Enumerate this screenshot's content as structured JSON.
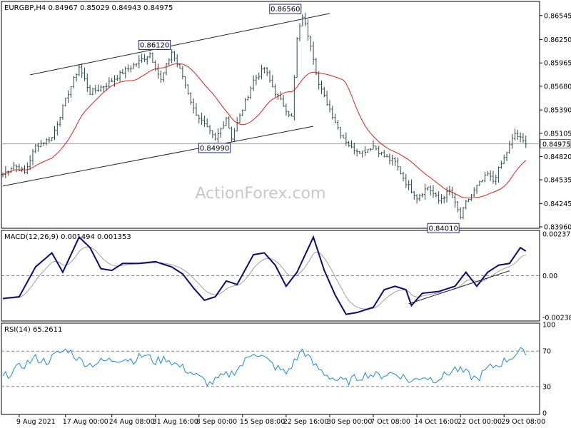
{
  "chart_data": [
    {
      "type": "ohlc",
      "panel": "price",
      "header": "EURGBP,H4  0.84967 0.85029 0.84943 0.84975",
      "ylim": [
        0.8396,
        0.867
      ],
      "y_ticks": [
        "0.86545",
        "0.86250",
        "0.85965",
        "0.85680",
        "0.85390",
        "0.85105",
        "0.84820",
        "0.84535",
        "0.84245",
        "0.83960"
      ],
      "y_tick_values": [
        0.86545,
        0.8625,
        0.85965,
        0.8568,
        0.8539,
        0.85105,
        0.8482,
        0.84535,
        0.84245,
        0.8396
      ],
      "current_price": 0.84975,
      "current_price_label": "0.84975",
      "watermark": "ActionForex.com",
      "annotations": [
        {
          "text": "0.86120",
          "value": 0.8612,
          "bar": 62
        },
        {
          "text": "0.86560",
          "value": 0.8656,
          "bar": 110
        },
        {
          "text": "0.84990",
          "value": 0.8499,
          "bar": 84
        },
        {
          "text": "0.84010",
          "value": 0.8401,
          "bar": 168
        }
      ],
      "channel_lines": [
        {
          "from": {
            "bar": 10,
            "value": 0.8582
          },
          "to": {
            "bar": 120,
            "value": 0.8657
          }
        },
        {
          "from": {
            "bar": 0,
            "value": 0.8446
          },
          "to": {
            "bar": 114,
            "value": 0.8519
          }
        }
      ],
      "ma_color": "#e0201c",
      "bar_color": "#2a4a4a"
    },
    {
      "type": "line",
      "panel": "macd",
      "header": "MACD(12,26,9) 0.001494 0.001353",
      "ylim": [
        -0.0025,
        0.0025
      ],
      "y_ticks": [
        "0.00237",
        "0.00",
        "-0.002387"
      ],
      "y_tick_values": [
        0.00237,
        0.0,
        -0.002387
      ],
      "macd_color": "#0a0a78",
      "signal_color": "#a0a0a0",
      "trend_line": {
        "from": {
          "bar": 149,
          "value": -0.0016
        },
        "to": {
          "bar": 186,
          "value": 0.00028
        }
      }
    },
    {
      "type": "line",
      "panel": "rsi",
      "header": "RSI(14) 65.2611",
      "ylim": [
        0,
        100
      ],
      "y_ticks": [
        "100",
        "70",
        "30",
        "0"
      ],
      "y_tick_values": [
        100,
        70,
        30,
        0
      ],
      "levels": [
        70,
        30
      ],
      "color": "#1e8ad6"
    }
  ],
  "x_axis": {
    "labels": [
      "9 Aug 2021",
      "17 Aug 00:00",
      "24 Aug 08:00",
      "31 Aug 16:00",
      "8 Sep 00:00",
      "15 Sep 08:00",
      "22 Sep 16:00",
      "30 Sep 00:00",
      "7 Oct 08:00",
      "14 Oct 16:00",
      "22 Oct 00:00",
      "29 Oct 08:00"
    ],
    "label_bars": [
      6,
      23,
      40,
      56,
      72,
      88,
      104,
      120,
      136,
      152,
      168,
      184
    ]
  },
  "price_path": [
    [
      0,
      0.846
    ],
    [
      4,
      0.8472
    ],
    [
      8,
      0.8462
    ],
    [
      12,
      0.8495
    ],
    [
      18,
      0.8505
    ],
    [
      24,
      0.856
    ],
    [
      28,
      0.8592
    ],
    [
      32,
      0.856
    ],
    [
      38,
      0.857
    ],
    [
      44,
      0.8585
    ],
    [
      50,
      0.8598
    ],
    [
      54,
      0.8608
    ],
    [
      58,
      0.8575
    ],
    [
      62,
      0.861
    ],
    [
      66,
      0.858
    ],
    [
      70,
      0.854
    ],
    [
      74,
      0.852
    ],
    [
      78,
      0.8502
    ],
    [
      82,
      0.853
    ],
    [
      84,
      0.8505
    ],
    [
      88,
      0.854
    ],
    [
      92,
      0.8575
    ],
    [
      96,
      0.859
    ],
    [
      100,
      0.856
    ],
    [
      104,
      0.854
    ],
    [
      106,
      0.853
    ],
    [
      108,
      0.8625
    ],
    [
      110,
      0.8654
    ],
    [
      113,
      0.862
    ],
    [
      116,
      0.857
    ],
    [
      120,
      0.854
    ],
    [
      124,
      0.851
    ],
    [
      128,
      0.8492
    ],
    [
      132,
      0.8488
    ],
    [
      136,
      0.8495
    ],
    [
      140,
      0.8482
    ],
    [
      144,
      0.8475
    ],
    [
      148,
      0.845
    ],
    [
      152,
      0.8432
    ],
    [
      156,
      0.8445
    ],
    [
      160,
      0.8428
    ],
    [
      164,
      0.844
    ],
    [
      168,
      0.8408
    ],
    [
      170,
      0.8425
    ],
    [
      174,
      0.8445
    ],
    [
      178,
      0.846
    ],
    [
      180,
      0.8452
    ],
    [
      184,
      0.848
    ],
    [
      188,
      0.851
    ],
    [
      192,
      0.8497
    ]
  ],
  "macd_path": [
    [
      0,
      -0.0013
    ],
    [
      6,
      -0.0012
    ],
    [
      12,
      0.0005
    ],
    [
      18,
      0.0013
    ],
    [
      22,
      0.0002
    ],
    [
      28,
      0.0022
    ],
    [
      32,
      0.0016
    ],
    [
      36,
      0.0004
    ],
    [
      40,
      0.0003
    ],
    [
      44,
      0.0007
    ],
    [
      50,
      0.0007
    ],
    [
      56,
      0.0008
    ],
    [
      62,
      0.0005
    ],
    [
      66,
      0.0001
    ],
    [
      70,
      -0.0007
    ],
    [
      74,
      -0.0014
    ],
    [
      78,
      -0.0012
    ],
    [
      82,
      -0.0003
    ],
    [
      86,
      -0.0005
    ],
    [
      92,
      0.0012
    ],
    [
      96,
      0.0013
    ],
    [
      100,
      0.0006
    ],
    [
      104,
      -0.0006
    ],
    [
      108,
      0.0002
    ],
    [
      114,
      0.0022
    ],
    [
      118,
      0.0003
    ],
    [
      122,
      -0.0011
    ],
    [
      126,
      -0.0022
    ],
    [
      130,
      -0.0021
    ],
    [
      136,
      -0.0018
    ],
    [
      140,
      -0.0008
    ],
    [
      144,
      -0.0006
    ],
    [
      148,
      -0.0008
    ],
    [
      150,
      -0.0017
    ],
    [
      154,
      -0.001
    ],
    [
      160,
      -0.0009
    ],
    [
      166,
      -0.0006
    ],
    [
      170,
      0.0002
    ],
    [
      174,
      -0.0006
    ],
    [
      178,
      0.0002
    ],
    [
      182,
      0.0006
    ],
    [
      186,
      0.0007
    ],
    [
      190,
      0.0016
    ],
    [
      192,
      0.0014
    ]
  ],
  "rsi_path": [
    [
      0,
      40
    ],
    [
      4,
      48
    ],
    [
      8,
      55
    ],
    [
      12,
      62
    ],
    [
      16,
      58
    ],
    [
      20,
      67
    ],
    [
      24,
      72
    ],
    [
      28,
      60
    ],
    [
      32,
      55
    ],
    [
      36,
      58
    ],
    [
      40,
      60
    ],
    [
      44,
      62
    ],
    [
      48,
      60
    ],
    [
      52,
      66
    ],
    [
      56,
      58
    ],
    [
      60,
      62
    ],
    [
      64,
      54
    ],
    [
      68,
      48
    ],
    [
      72,
      40
    ],
    [
      76,
      33
    ],
    [
      80,
      40
    ],
    [
      84,
      45
    ],
    [
      88,
      55
    ],
    [
      92,
      70
    ],
    [
      96,
      62
    ],
    [
      100,
      52
    ],
    [
      104,
      45
    ],
    [
      108,
      62
    ],
    [
      110,
      72
    ],
    [
      114,
      55
    ],
    [
      118,
      45
    ],
    [
      122,
      38
    ],
    [
      126,
      35
    ],
    [
      130,
      40
    ],
    [
      134,
      44
    ],
    [
      138,
      42
    ],
    [
      142,
      45
    ],
    [
      146,
      43
    ],
    [
      150,
      35
    ],
    [
      154,
      42
    ],
    [
      158,
      38
    ],
    [
      162,
      42
    ],
    [
      166,
      50
    ],
    [
      170,
      45
    ],
    [
      174,
      38
    ],
    [
      178,
      50
    ],
    [
      182,
      55
    ],
    [
      186,
      62
    ],
    [
      190,
      70
    ],
    [
      192,
      65
    ]
  ]
}
